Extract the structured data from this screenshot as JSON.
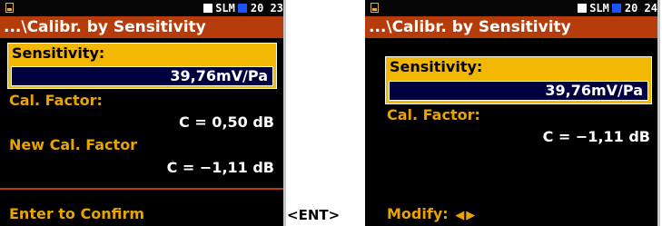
{
  "left_screen": {
    "status": {
      "mode": "SLM",
      "time": "20 23"
    },
    "path": "...\\Calibr. by Sensitivity",
    "sensitivity_label": "Sensitivity:",
    "sensitivity_value": "39,76mV/Pa",
    "cal_factor_label": "Cal. Factor:",
    "cal_factor_value": "C = 0,50 dB",
    "new_cal_factor_label": "New Cal. Factor",
    "new_cal_factor_value": "C = −1,11 dB",
    "confirm_text": "Enter to Confirm"
  },
  "transition_label": "<ENT>",
  "right_screen": {
    "status": {
      "mode": "SLM",
      "time": "20 24"
    },
    "path": "...\\Calibr. by Sensitivity",
    "sensitivity_label": "Sensitivity:",
    "sensitivity_value": "39,76mV/Pa",
    "cal_factor_label": "Cal. Factor:",
    "cal_factor_value": "C = −1,11 dB",
    "modify_label": "Modify:",
    "modify_icons": [
      "arrow-left-icon",
      "arrow-right-icon"
    ]
  },
  "colors": {
    "accent_orange": "#b63d0b",
    "highlight_yellow": "#f2b700",
    "label_gold": "#e8a400",
    "indicator_blue": "#1b54ff"
  }
}
